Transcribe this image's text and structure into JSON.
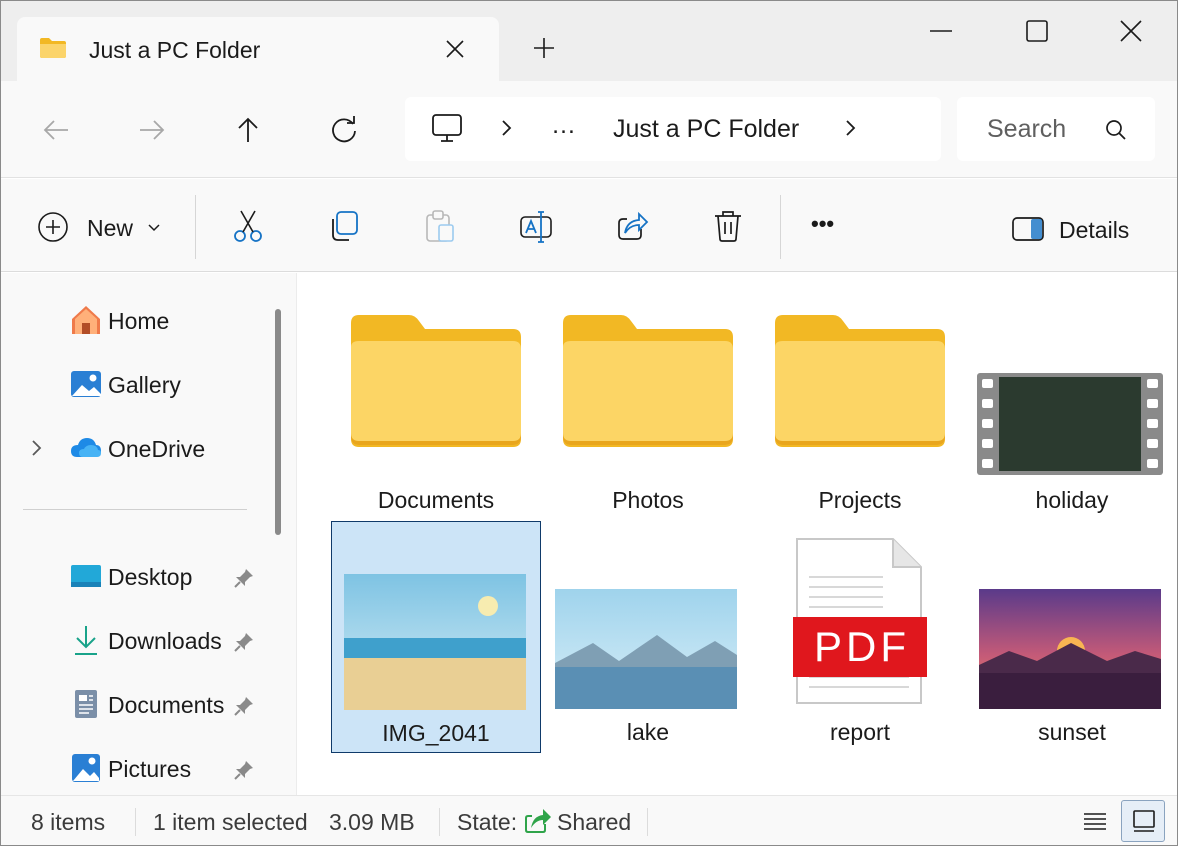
{
  "window": {
    "tab_title": "Just a PC Folder",
    "controls": [
      "minimize",
      "maximize",
      "close"
    ]
  },
  "nav": {
    "address_segments": [
      "…",
      "Just a PC Folder"
    ],
    "search_placeholder": "Search"
  },
  "toolbar": {
    "new_label": "New",
    "details_label": "Details",
    "more_label": "•••",
    "icons": [
      "cut-icon",
      "copy-icon",
      "paste-icon",
      "rename-icon",
      "share-icon",
      "delete-icon"
    ]
  },
  "sidebar": {
    "items": [
      {
        "label": "Home",
        "icon": "home-icon"
      },
      {
        "label": "Gallery",
        "icon": "gallery-icon"
      },
      {
        "label": "OneDrive",
        "icon": "onedrive-icon",
        "expandable": true
      }
    ],
    "pinned": [
      {
        "label": "Desktop",
        "icon": "desktop-icon"
      },
      {
        "label": "Downloads",
        "icon": "downloads-icon"
      },
      {
        "label": "Documents",
        "icon": "documents-icon"
      },
      {
        "label": "Pictures",
        "icon": "pictures-icon"
      }
    ]
  },
  "files": [
    {
      "name": "Documents",
      "type": "folder"
    },
    {
      "name": "Photos",
      "type": "folder"
    },
    {
      "name": "Projects",
      "type": "folder"
    },
    {
      "name": "holiday",
      "type": "video"
    },
    {
      "name": "IMG_2041",
      "type": "image",
      "selected": true
    },
    {
      "name": "lake",
      "type": "image"
    },
    {
      "name": "report",
      "type": "pdf",
      "badge": "PDF"
    },
    {
      "name": "sunset",
      "type": "image"
    }
  ],
  "status": {
    "item_count": "8 items",
    "selection": "1 item selected",
    "size": "3.09 MB",
    "state_label": "State:",
    "state_value": "Shared"
  },
  "colors": {
    "folder": "#f7c948",
    "accent": "#0067c0",
    "selection_bg": "#cce4f7",
    "pdf_red": "#e0171d"
  }
}
